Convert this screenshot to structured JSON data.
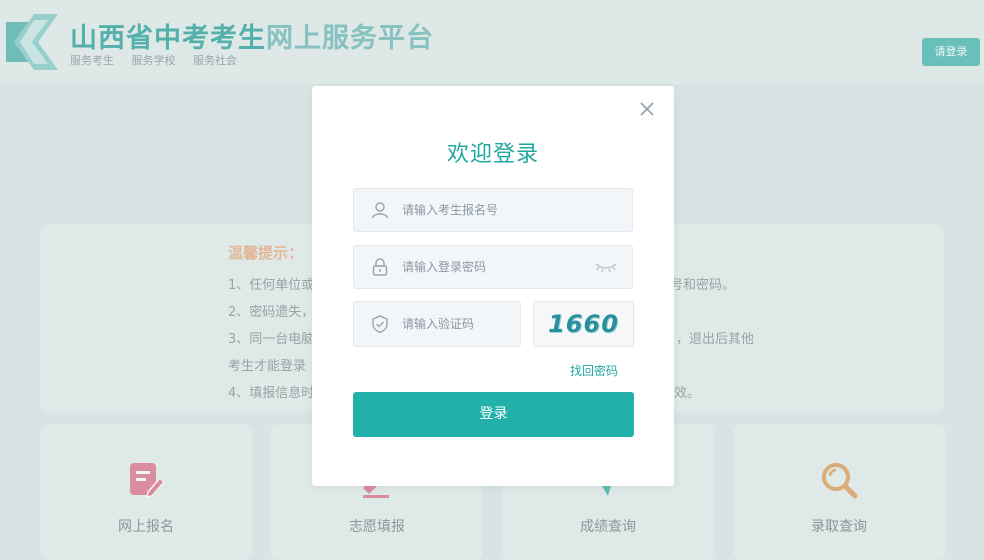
{
  "header": {
    "title_main": "山西省中考考生",
    "title_rest": "网上服务平台",
    "slogans": [
      "服务考生",
      "服务学校",
      "服务社会"
    ],
    "login_button": "请登录"
  },
  "tips": {
    "title": "温馨提示：",
    "lines_left": [
      "1、任何单位或",
      "2、密码遗失，",
      "3、同一台电脑",
      "考生才能登录",
      "4、填报信息时"
    ],
    "lines_right": [
      "号和密码。",
      "，退出后其他",
      "效。"
    ]
  },
  "services": [
    {
      "label": "网上报名",
      "icon": "edit-form-icon",
      "color": "#e07f95"
    },
    {
      "label": "志愿填报",
      "icon": "pen-icon",
      "color": "#e07f95"
    },
    {
      "label": "成绩查询",
      "icon": "chart-icon",
      "color": "#4cb8b1"
    },
    {
      "label": "录取查询",
      "icon": "magnifier-icon",
      "color": "#e2a466"
    }
  ],
  "modal": {
    "title": "欢迎登录",
    "username_placeholder": "请输入考生报名号",
    "password_placeholder": "请输入登录密码",
    "captcha_placeholder": "请输入验证码",
    "captcha_code": "1660",
    "forgot_link": "找回密码",
    "login_button": "登录"
  },
  "colors": {
    "accent": "#21b0aa",
    "brand_teal": "#3eaaa4",
    "tips_title": "#e8b48a"
  }
}
